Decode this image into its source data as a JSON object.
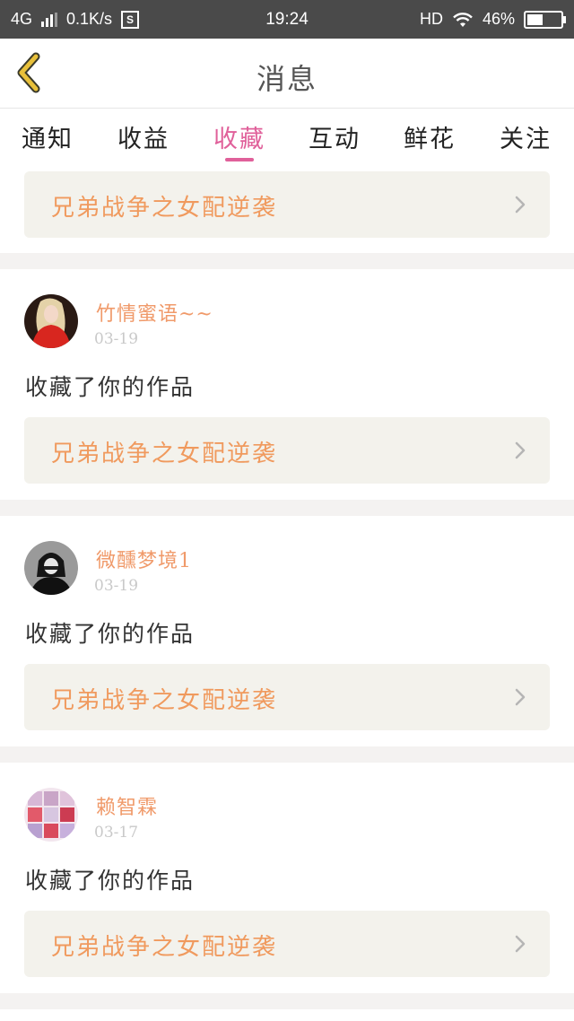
{
  "status_bar": {
    "network": "4G",
    "speed": "0.1K/s",
    "s_badge": "S",
    "time": "19:24",
    "hd": "HD",
    "battery_text": "46%",
    "battery_level": 0.46
  },
  "header": {
    "title": "消息"
  },
  "tabs": [
    {
      "label": "通知",
      "active": false
    },
    {
      "label": "收益",
      "active": false
    },
    {
      "label": "收藏",
      "active": true
    },
    {
      "label": "互动",
      "active": false
    },
    {
      "label": "鲜花",
      "active": false
    },
    {
      "label": "关注",
      "active": false
    }
  ],
  "top_card": {
    "work_title": "兄弟战争之女配逆袭"
  },
  "items": [
    {
      "user": "竹情蜜语~~",
      "date": "03-19",
      "action": "收藏了你的作品",
      "work_title": "兄弟战争之女配逆袭",
      "avatar": "avatar-red-dress"
    },
    {
      "user": "微醺梦境1",
      "date": "03-19",
      "action": "收藏了你的作品",
      "work_title": "兄弟战争之女配逆袭",
      "avatar": "avatar-dark-figure"
    },
    {
      "user": "赖智霖",
      "date": "03-17",
      "action": "收藏了你的作品",
      "work_title": "兄弟战争之女配逆袭",
      "avatar": "avatar-collage"
    }
  ],
  "colors": {
    "accent_pink": "#e0609a",
    "title_orange": "#f09a5e",
    "back_arrow": "#e8c03a"
  }
}
